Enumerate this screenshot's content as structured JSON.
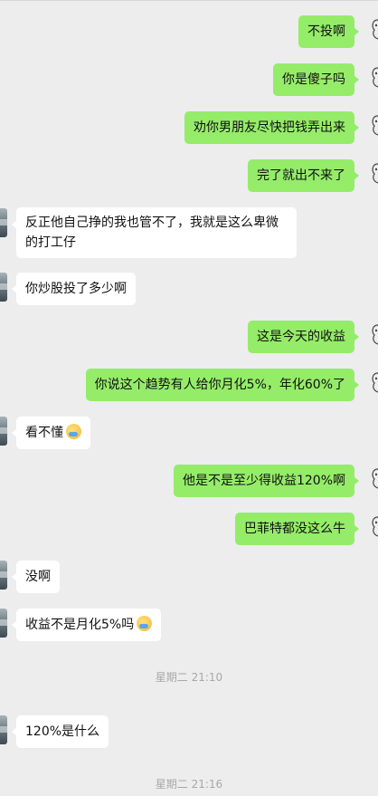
{
  "messages": [
    {
      "side": "out",
      "text": "不投啊"
    },
    {
      "side": "out",
      "text": "你是傻子吗"
    },
    {
      "side": "out",
      "text": "劝你男朋友尽快把钱弄出来"
    },
    {
      "side": "out",
      "text": "完了就出不来了"
    },
    {
      "side": "in",
      "text": "反正他自己挣的我也管不了，我就是这么卑微的打工仔"
    },
    {
      "side": "in",
      "text": "你炒股投了多少啊"
    },
    {
      "side": "out",
      "text": "这是今天的收益"
    },
    {
      "side": "out",
      "text": "你说这个趋势有人给你月化5%，年化60%了"
    },
    {
      "side": "in",
      "text": "看不懂",
      "emoji": "sweat-smile-emoji"
    },
    {
      "side": "out",
      "text": "他是不是至少得收益120%啊"
    },
    {
      "side": "out",
      "text": "巴菲特都没这么牛"
    },
    {
      "side": "in",
      "text": "没啊"
    },
    {
      "side": "in",
      "text": "收益不是月化5%吗",
      "emoji": "sweat-smile-emoji"
    },
    {
      "side": "in",
      "text": "120%是什么"
    }
  ],
  "timestamps": [
    "星期二 21:10",
    "星期二 21:16"
  ],
  "colors": {
    "background": "#ededed",
    "outgoing_bubble": "#95ec69",
    "incoming_bubble": "#ffffff",
    "timestamp_text": "#a8a8a8"
  }
}
